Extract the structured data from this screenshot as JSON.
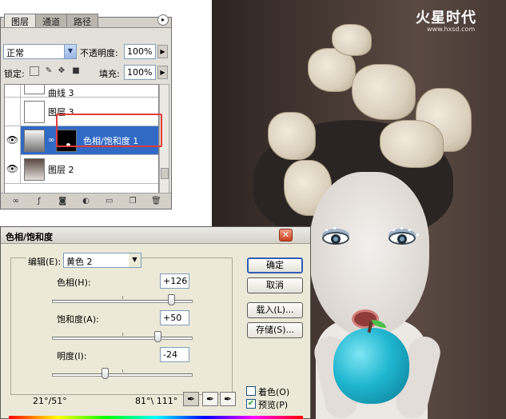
{
  "brand": {
    "logo": "火星时代",
    "url": "www.hxsd.com"
  },
  "layers_panel": {
    "tabs": [
      "图层",
      "通道",
      "路径"
    ],
    "blend_mode": "正常",
    "opacity_label": "不透明度:",
    "opacity_value": "100%",
    "lock_label": "锁定:",
    "fill_label": "填充:",
    "fill_value": "100%",
    "layers": [
      {
        "name": "曲线 3",
        "visible": false
      },
      {
        "name": "图层 3",
        "visible": false
      },
      {
        "name": "色相/饱和度 1",
        "visible": true,
        "selected": true
      },
      {
        "name": "图层 2",
        "visible": true
      }
    ]
  },
  "dialog": {
    "title": "色相/饱和度",
    "edit_label": "编辑(E):",
    "edit_value": "黄色 2",
    "hue_label": "色相(H):",
    "hue_value": "+126",
    "saturation_label": "饱和度(A):",
    "saturation_value": "+50",
    "lightness_label": "明度(I):",
    "lightness_value": "-24",
    "hue_level": 0.85,
    "saturation_level": 0.75,
    "lightness_level": 0.38,
    "range_left": "21°/51°",
    "range_right": "81°\\ 111°",
    "buttons": {
      "ok": "确定",
      "cancel": "取消",
      "load": "载入(L)...",
      "save": "存储(S)..."
    },
    "colorize_label": "着色(O)",
    "colorize_checked": false,
    "preview_label": "预览(P)",
    "preview_checked": true
  },
  "colors": {
    "selection": "#316ac5",
    "highlight_box": "#e23b3b",
    "apple": "#1fb6d0"
  },
  "icons": [
    "close-icon",
    "panel-menu-icon",
    "eye-icon",
    "link-icon",
    "lock-icon",
    "eyedropper-icon",
    "eyedropper-plus-icon",
    "eyedropper-minus-icon"
  ]
}
